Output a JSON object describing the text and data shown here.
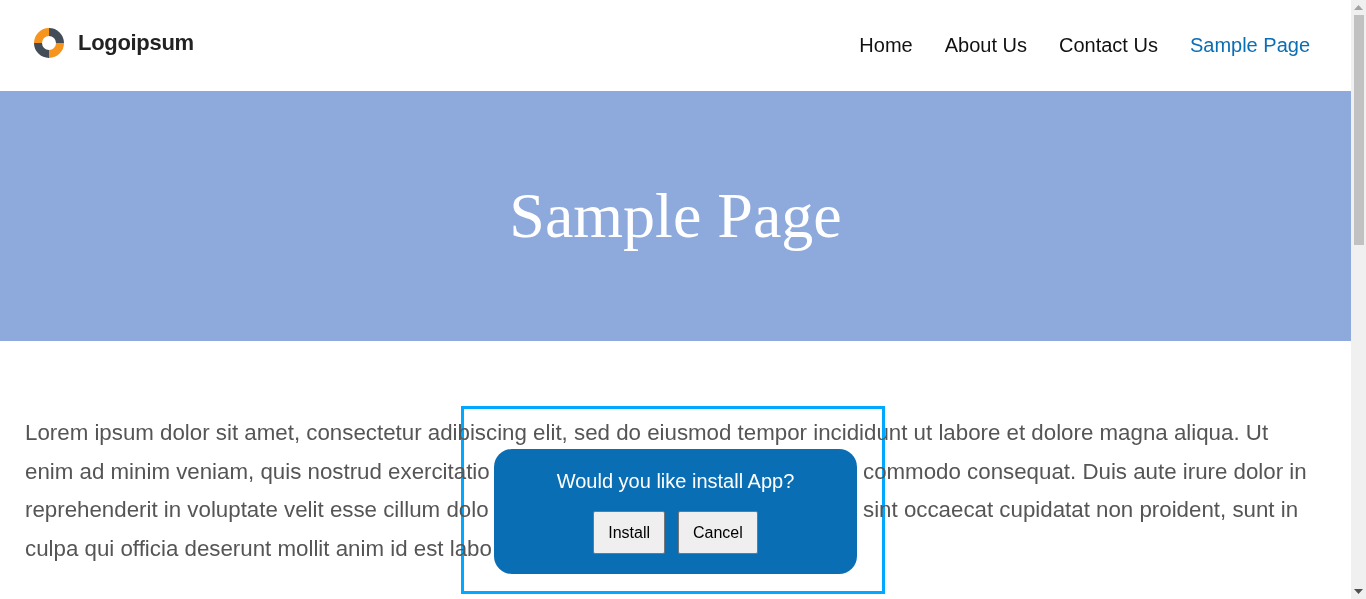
{
  "logo": {
    "text": "Logoipsum"
  },
  "nav": [
    {
      "label": "Home",
      "selected": false
    },
    {
      "label": "About Us",
      "selected": false
    },
    {
      "label": "Contact Us",
      "selected": false
    },
    {
      "label": "Sample Page",
      "selected": true
    }
  ],
  "hero": {
    "title": "Sample Page"
  },
  "paragraph_lines": [
    {
      "left": "Lorem ipsum dolor sit amet, consectetur adibiscing elit, sed do eiusmod tempor incididunt ut labore et dolore magna aliqua. Ut"
    },
    {
      "left": "enim ad minim veniam, quis nostrud exercitatio",
      "right": "commodo consequat. Duis aute irure dolor in"
    },
    {
      "left": "reprehenderit in voluptate velit esse cillum dolo",
      "right": "sint occaecat cupidatat non proident, sunt in"
    },
    {
      "left": "culpa qui officia deserunt mollit anim id est labo"
    }
  ],
  "install_prompt": {
    "message": "Would you like install App?",
    "buttons": [
      "Install",
      "Cancel"
    ],
    "highlighted": true
  }
}
